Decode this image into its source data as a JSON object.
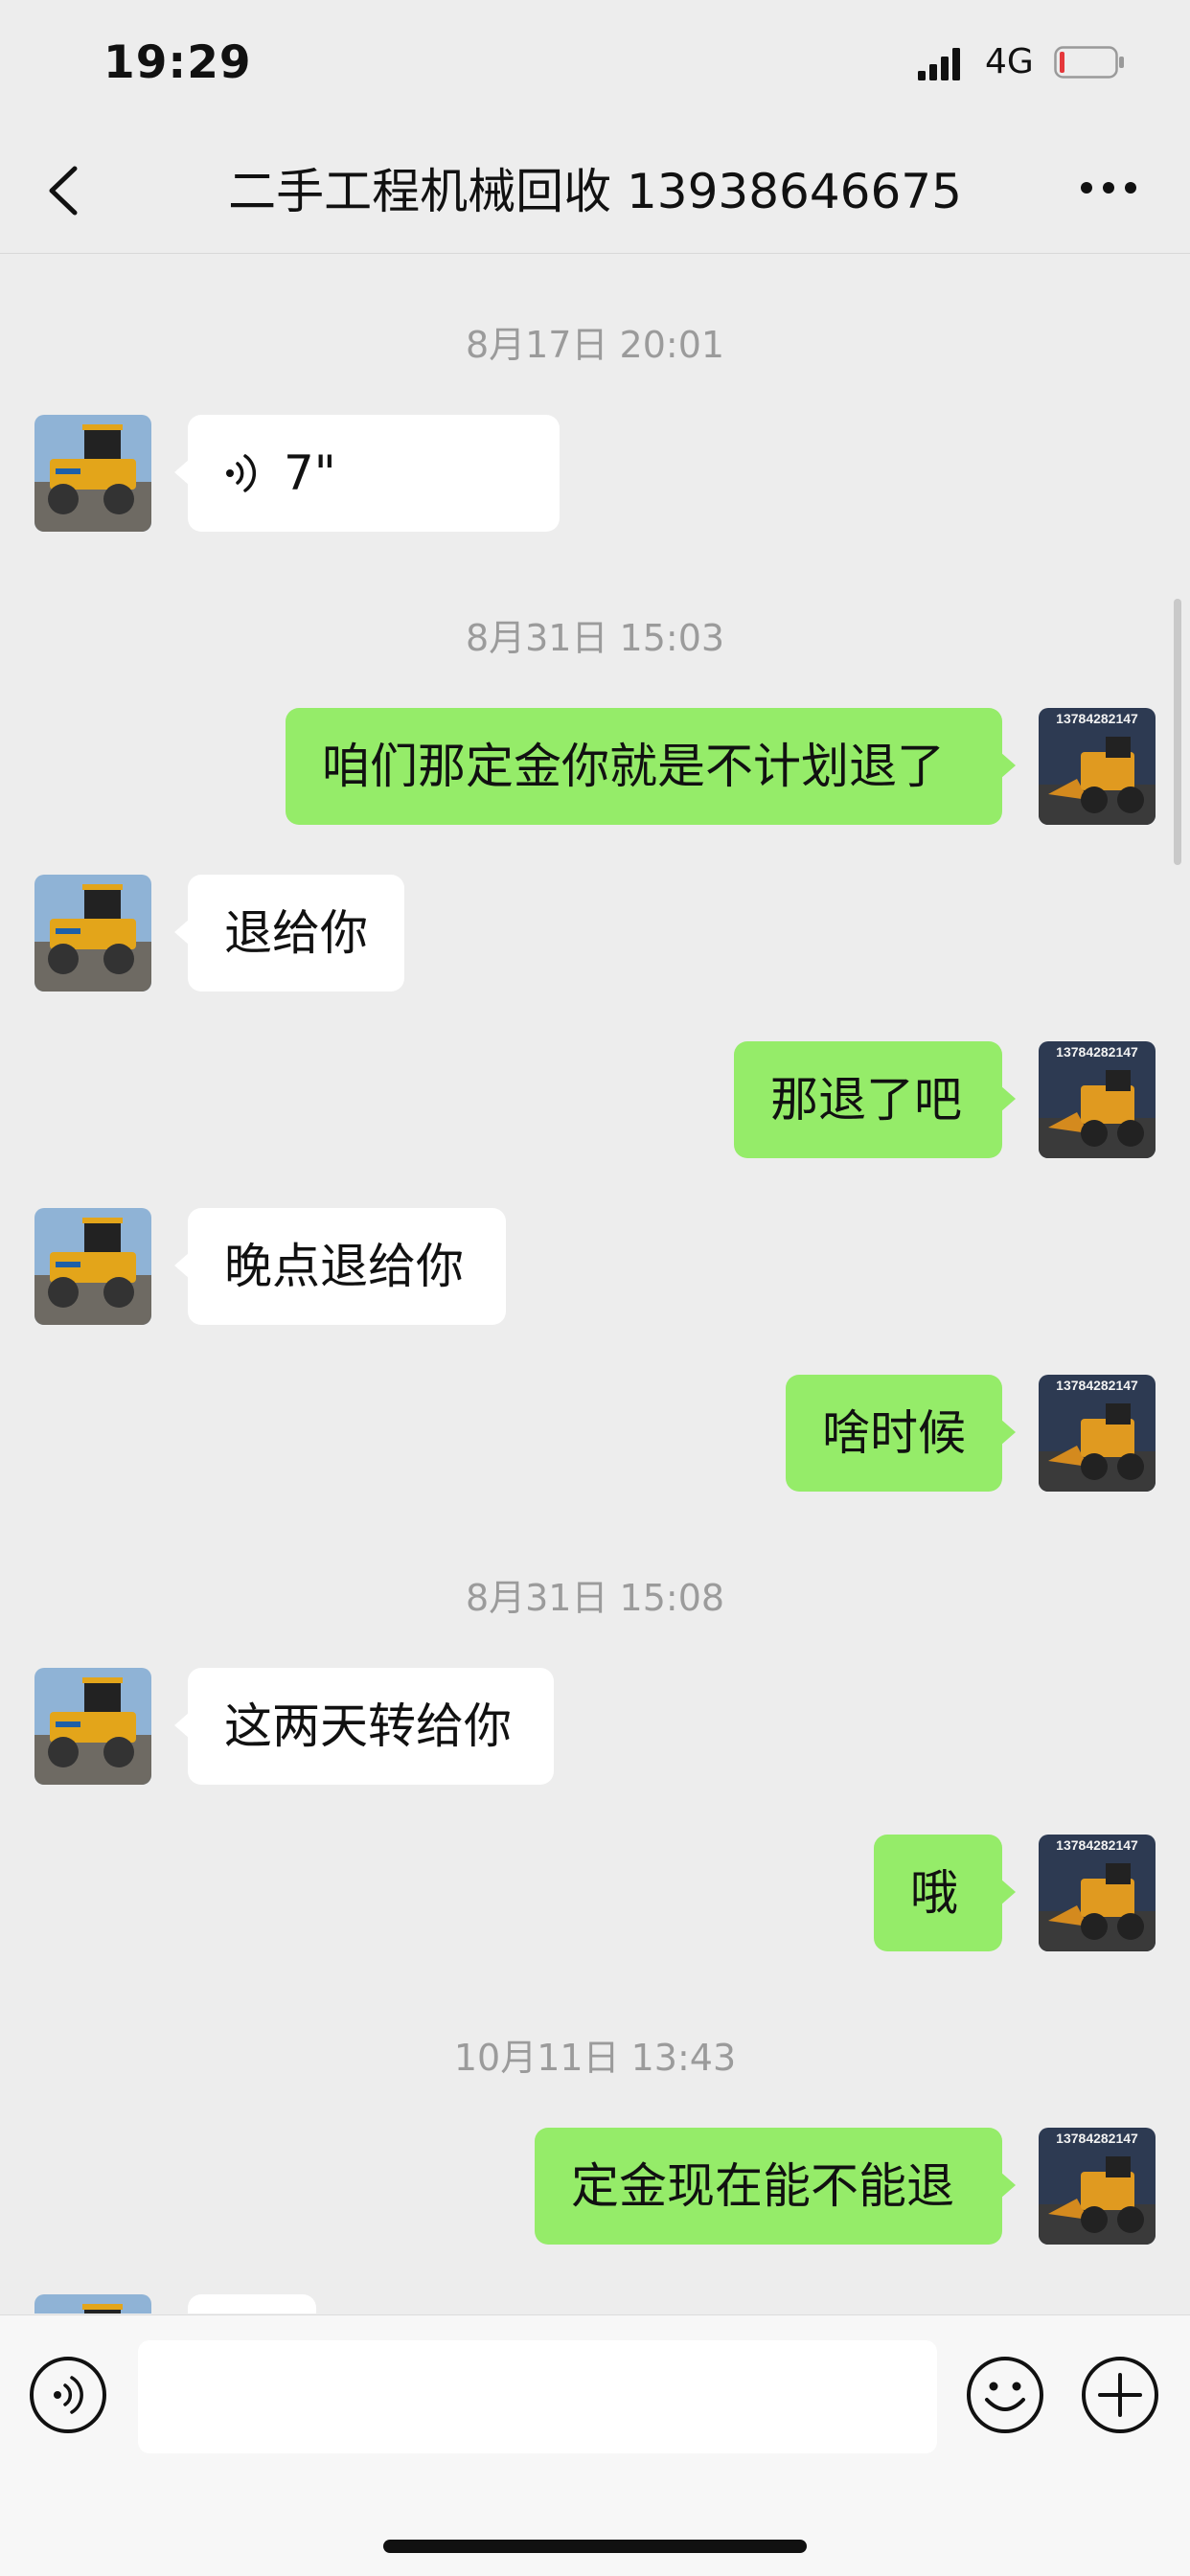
{
  "status": {
    "time": "19:29",
    "network": "4G"
  },
  "nav": {
    "title": "二手工程机械回收 13938646675"
  },
  "avatars": {
    "me_label": "13784282147"
  },
  "messages": {
    "ts1": "8月17日 20:01",
    "m1_voice": "7\"",
    "ts2": "8月31日 15:03",
    "m2": "咱们那定金你就是不计划退了",
    "m3": "退给你",
    "m4": "那退了吧",
    "m5": "晚点退给你",
    "m6": "啥时候",
    "ts3": "8月31日 15:08",
    "m7": "这两天转给你",
    "m8": "哦",
    "ts4": "10月11日 13:43",
    "m9": "定金现在能不能退"
  },
  "input": {
    "value": "",
    "placeholder": ""
  },
  "colors": {
    "background": "#ededed",
    "outgoing_bubble": "#95ec69",
    "incoming_bubble": "#ffffff",
    "timestamp": "#9b9b9b"
  }
}
